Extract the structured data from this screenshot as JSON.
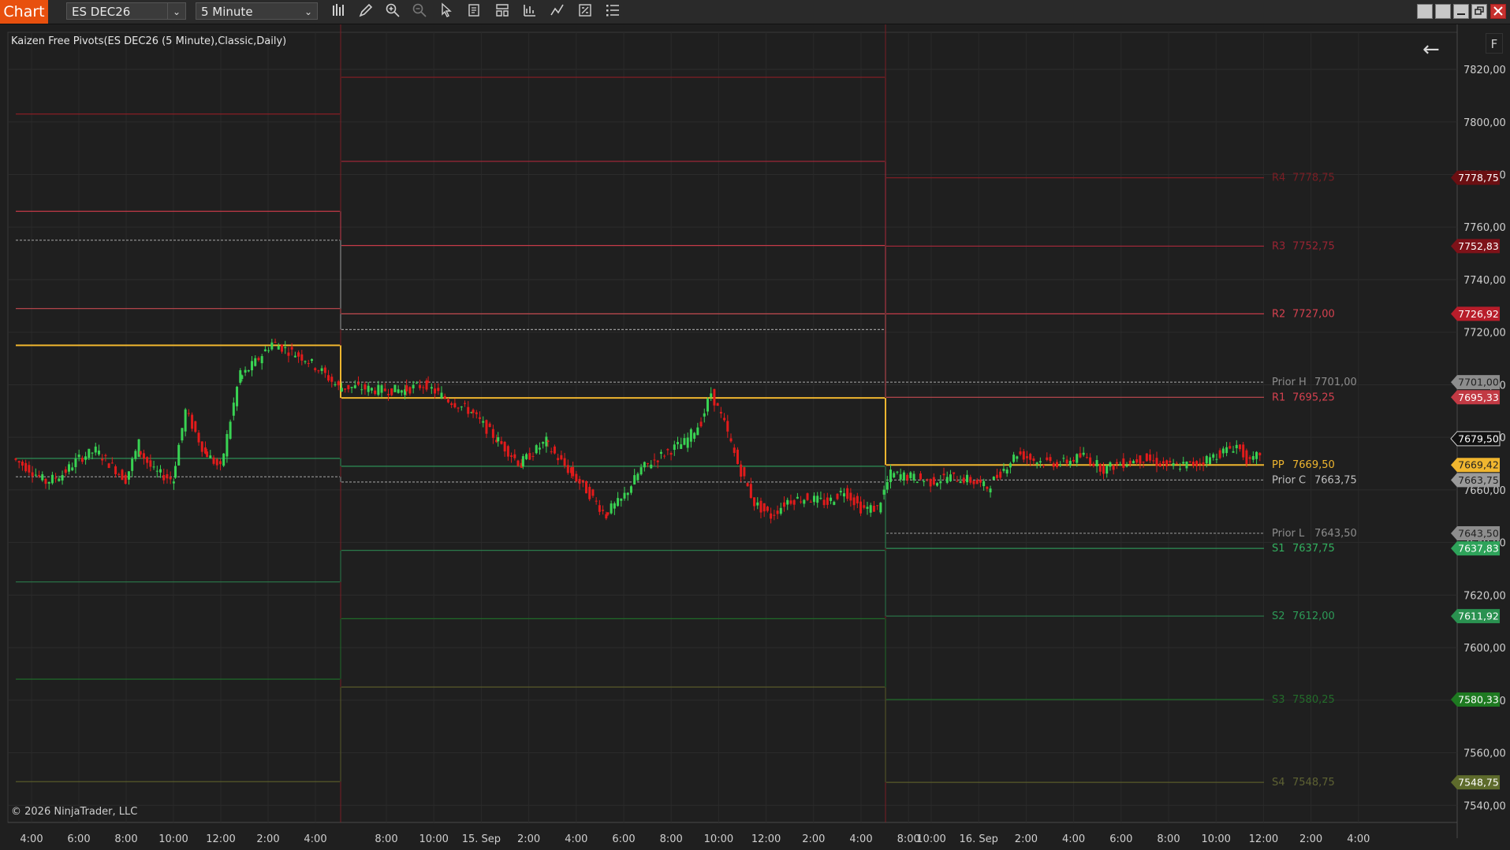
{
  "app": {
    "title": "Chart"
  },
  "toolbar": {
    "instrument": "ES DEC26",
    "interval": "5 Minute",
    "dropdown_arrow": "⌄"
  },
  "chart": {
    "indicator_label": "Kaizen Free Pivots(ES DEC26 (5 Minute),Classic,Daily)",
    "copyright": "© 2026 NinjaTrader, LLC",
    "f_button": "F",
    "colors": {
      "background": "#1f1f1f",
      "up_candle": "#39d353",
      "down_candle": "#e21b1b",
      "pivot": "#f0b62f",
      "resistance": "#c43a48",
      "support": "#2fa45a",
      "prior": "#9a9a9a"
    }
  },
  "chart_data": {
    "type": "line",
    "price_axis": {
      "ticks": [
        "7820,00",
        "7800,00",
        "7780,00",
        "7760,00",
        "7740,00",
        "7720,00",
        "7700,00",
        "7680,00",
        "7660,00",
        "7640,00",
        "7620,00",
        "7600,00",
        "7580,00",
        "7560,00",
        "7540,00"
      ],
      "ylim": [
        7534,
        7830
      ]
    },
    "time_axis": {
      "ticks": [
        "4:00",
        "6:00",
        "8:00",
        "10:00",
        "12:00",
        "2:00",
        "4:00",
        "8:00",
        "10:00",
        "15. Sep",
        "2:00",
        "4:00",
        "6:00",
        "8:00",
        "10:00",
        "12:00",
        "2:00",
        "4:00",
        "8:00",
        "10:00",
        "16. Sep",
        "2:00",
        "4:00",
        "6:00",
        "8:00",
        "10:00",
        "12:00",
        "2:00",
        "4:00"
      ]
    },
    "current_price": "7679,50",
    "pivot_levels_day3": [
      {
        "name": "R4",
        "label": "R4",
        "value": "7778,75",
        "tag": "7778,75",
        "kind": "r4"
      },
      {
        "name": "R3",
        "label": "R3",
        "value": "7752,75",
        "tag": "7752,83",
        "kind": "r3"
      },
      {
        "name": "R2",
        "label": "R2",
        "value": "7727,00",
        "tag": "7726,92",
        "kind": "r2"
      },
      {
        "name": "Prior H",
        "label": "Prior H",
        "value": "7701,00",
        "tag": "7701,00",
        "kind": "prior"
      },
      {
        "name": "R1",
        "label": "R1",
        "value": "7695,25",
        "tag": "7695,33",
        "kind": "r1"
      },
      {
        "name": "PP",
        "label": "PP",
        "value": "7669,50",
        "tag": "7669,42",
        "kind": "pp"
      },
      {
        "name": "Prior C",
        "label": "Prior C",
        "value": "7663,75",
        "tag": "7663,75",
        "kind": "priorc"
      },
      {
        "name": "Prior L",
        "label": "Prior L",
        "value": "7643,50",
        "tag": "7643,50",
        "kind": "prior"
      },
      {
        "name": "S1",
        "label": "S1",
        "value": "7637,75",
        "tag": "7637,83",
        "kind": "s1"
      },
      {
        "name": "S2",
        "label": "S2",
        "value": "7612,00",
        "tag": "7611,92",
        "kind": "s2"
      },
      {
        "name": "S3",
        "label": "S3",
        "value": "7580,25",
        "tag": "7580,33",
        "kind": "s3"
      },
      {
        "name": "S4",
        "label": "S4",
        "value": "7548,75",
        "tag": "7548,75",
        "kind": "s4"
      }
    ],
    "pivot_levels_day2": [
      {
        "kind": "r4",
        "value": 7817
      },
      {
        "kind": "r3",
        "value": 7785
      },
      {
        "kind": "r2",
        "value": 7753
      },
      {
        "kind": "r1",
        "value": 7727
      },
      {
        "kind": "priorh",
        "value": 7721
      },
      {
        "kind": "prior",
        "value": 7701
      },
      {
        "kind": "pp",
        "value": 7695
      },
      {
        "kind": "priorc",
        "value": 7663
      },
      {
        "kind": "s1",
        "value": 7669
      },
      {
        "kind": "s2",
        "value": 7637
      },
      {
        "kind": "s3",
        "value": 7611
      },
      {
        "kind": "s4",
        "value": 7585
      }
    ],
    "pivot_levels_day1": [
      {
        "kind": "r4",
        "value": 7803
      },
      {
        "kind": "r2",
        "value": 7766
      },
      {
        "kind": "priorh",
        "value": 7755
      },
      {
        "kind": "r1",
        "value": 7729
      },
      {
        "kind": "pp",
        "value": 7715
      },
      {
        "kind": "s1",
        "value": 7672
      },
      {
        "kind": "priorc",
        "value": 7665
      },
      {
        "kind": "s2",
        "value": 7625
      },
      {
        "kind": "s3",
        "value": 7588
      },
      {
        "kind": "s4",
        "value": 7549
      }
    ],
    "price_path": [
      [
        0,
        7672
      ],
      [
        10,
        7668
      ],
      [
        20,
        7663
      ],
      [
        30,
        7666
      ],
      [
        40,
        7672
      ],
      [
        50,
        7675
      ],
      [
        60,
        7669
      ],
      [
        68,
        7664
      ],
      [
        75,
        7676
      ],
      [
        85,
        7667
      ],
      [
        96,
        7664
      ],
      [
        104,
        7690
      ],
      [
        115,
        7675
      ],
      [
        125,
        7668
      ],
      [
        136,
        7702
      ],
      [
        148,
        7710
      ],
      [
        156,
        7716
      ],
      [
        166,
        7713
      ],
      [
        176,
        7710
      ],
      [
        186,
        7705
      ],
      [
        196,
        7699
      ],
      [
        206,
        7699
      ],
      [
        220,
        7698
      ],
      [
        235,
        7698
      ],
      [
        248,
        7700
      ],
      [
        260,
        7695
      ],
      [
        275,
        7690
      ],
      [
        290,
        7680
      ],
      [
        305,
        7670
      ],
      [
        320,
        7678
      ],
      [
        335,
        7667
      ],
      [
        345,
        7660
      ],
      [
        356,
        7651
      ],
      [
        366,
        7656
      ],
      [
        378,
        7668
      ],
      [
        392,
        7674
      ],
      [
        404,
        7678
      ],
      [
        414,
        7686
      ],
      [
        420,
        7697
      ],
      [
        428,
        7685
      ],
      [
        436,
        7670
      ],
      [
        446,
        7655
      ],
      [
        456,
        7650
      ],
      [
        466,
        7656
      ],
      [
        478,
        7657
      ],
      [
        490,
        7655
      ],
      [
        500,
        7660
      ],
      [
        510,
        7653
      ],
      [
        520,
        7653
      ],
      [
        528,
        7666
      ],
      [
        540,
        7665
      ],
      [
        552,
        7663
      ],
      [
        562,
        7665
      ],
      [
        574,
        7664
      ],
      [
        586,
        7661
      ],
      [
        596,
        7668
      ],
      [
        604,
        7674
      ],
      [
        616,
        7671
      ],
      [
        630,
        7670
      ],
      [
        644,
        7673
      ],
      [
        656,
        7668
      ],
      [
        666,
        7670
      ],
      [
        680,
        7672
      ],
      [
        696,
        7669
      ],
      [
        712,
        7670
      ],
      [
        726,
        7674
      ],
      [
        736,
        7677
      ],
      [
        744,
        7670
      ],
      [
        750,
        7674
      ]
    ]
  }
}
